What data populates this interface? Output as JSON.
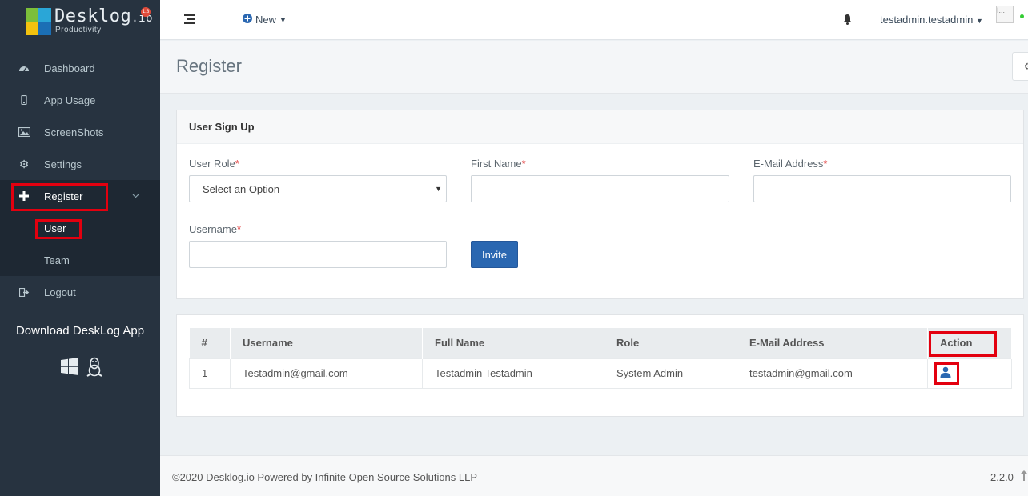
{
  "brand": {
    "name": "Desklog",
    "tld": ".io",
    "tagline": "Productivity",
    "badge": "1.8"
  },
  "sidebar": {
    "items": [
      {
        "label": "Dashboard",
        "icon": "dashboard-icon"
      },
      {
        "label": "App Usage",
        "icon": "mobile-icon"
      },
      {
        "label": "ScreenShots",
        "icon": "image-icon"
      },
      {
        "label": "Settings",
        "icon": "gear-icon"
      },
      {
        "label": "Register",
        "icon": "plus-icon"
      },
      {
        "label": "Logout",
        "icon": "sign-out-icon"
      }
    ],
    "register_submenu": [
      {
        "label": "User"
      },
      {
        "label": "Team"
      }
    ],
    "download_label": "Download DeskLog App"
  },
  "topbar": {
    "new_label": "New",
    "username": "testadmin.testadmin",
    "avatar_alt": "I..."
  },
  "page": {
    "title": "Register"
  },
  "signup": {
    "heading": "User Sign Up",
    "role_label": "User Role",
    "role_value": "Select an Option",
    "first_name_label": "First Name",
    "email_label": "E-Mail Address",
    "username_label": "Username",
    "required_mark": "*",
    "invite_label": "Invite"
  },
  "table": {
    "columns": [
      "#",
      "Username",
      "Full Name",
      "Role",
      "E-Mail Address",
      "Action"
    ],
    "rows": [
      {
        "num": "1",
        "username": "Testadmin@gmail.com",
        "full_name": "Testadmin Testadmin",
        "role": "System Admin",
        "email": "testadmin@gmail.com"
      }
    ]
  },
  "footer": {
    "copyright": "©2020 Desklog.io Powered by Infinite Open Source Solutions LLP",
    "version": "2.2.0"
  },
  "colors": {
    "sidebar_bg": "#273340",
    "accent": "#2a67b1",
    "highlight": "#e3000f"
  }
}
